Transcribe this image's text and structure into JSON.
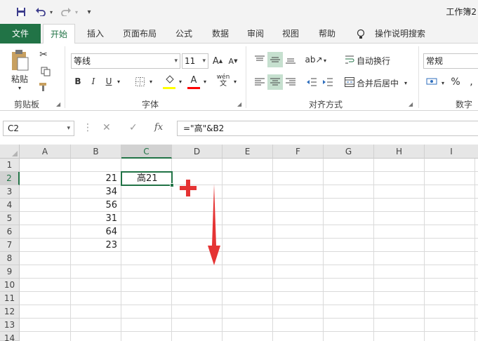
{
  "title_bar": {
    "save_icon": "save-icon",
    "undo_icon": "undo-icon",
    "redo_icon": "redo-icon",
    "customize_icon": "customize-quick-access-icon",
    "document_title": "工作簿2"
  },
  "tabs": {
    "file": "文件",
    "items": [
      "开始",
      "插入",
      "页面布局",
      "公式",
      "数据",
      "审阅",
      "视图",
      "帮助"
    ],
    "tell_me": "操作说明搜索"
  },
  "ribbon": {
    "clipboard": {
      "paste_label": "粘贴",
      "group_label": "剪贴板"
    },
    "font": {
      "font_name": "等线",
      "font_size": "11",
      "bold": "B",
      "italic": "I",
      "underline": "U",
      "group_label": "字体",
      "phonetic": "wén"
    },
    "alignment": {
      "wrap_text": "自动换行",
      "merge_center": "合并后居中",
      "group_label": "对齐方式"
    },
    "number": {
      "format": "常规",
      "percent": "%",
      "group_label": "数字"
    },
    "colors": {
      "accent": "#217346",
      "fill_highlight": "#ffff00",
      "font_color": "#ff0000"
    }
  },
  "formula_bar": {
    "name_box": "C2",
    "cancel_icon": "cancel-icon",
    "enter_icon": "checkmark-icon",
    "fx": "fx",
    "formula": "=\"高\"&B2"
  },
  "grid": {
    "columns": [
      "A",
      "B",
      "C",
      "D",
      "E",
      "F",
      "G",
      "H",
      "I"
    ],
    "rows": [
      "1",
      "2",
      "3",
      "4",
      "5",
      "6",
      "7",
      "8",
      "9",
      "10",
      "11",
      "12",
      "13",
      "14"
    ],
    "selected_cell": "C2",
    "column_b_values": [
      "21",
      "34",
      "56",
      "31",
      "64",
      "23"
    ],
    "c2_value": "高21"
  },
  "annotations": {
    "plus_color": "#e53333",
    "arrow_color": "#e53333"
  }
}
